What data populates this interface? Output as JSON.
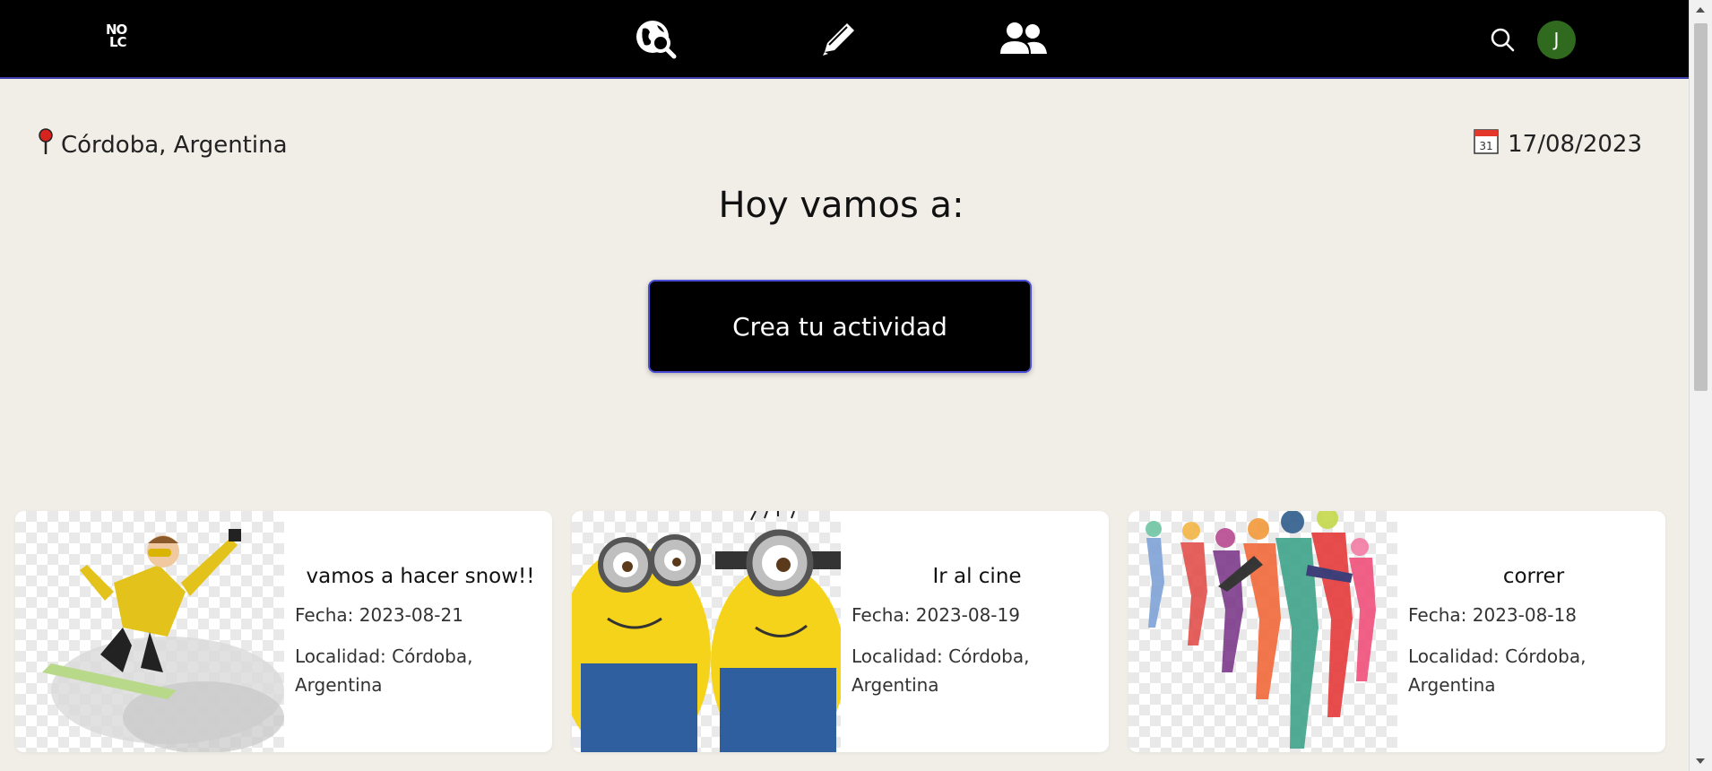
{
  "nav": {
    "logo_line1": "NO",
    "logo_line2": "LC",
    "icons": [
      "globe-search-icon",
      "pencil-icon",
      "users-icon"
    ],
    "search_icon": "search-icon",
    "avatar_initial": "J",
    "avatar_color": "#2f6a1e"
  },
  "header": {
    "location_icon": "pin-icon",
    "location": "Córdoba, Argentina",
    "date_icon": "calendar-icon",
    "calendar_day": "31",
    "date": "17/08/2023"
  },
  "main": {
    "headline": "Hoy vamos a:",
    "create_button": "Crea tu actividad"
  },
  "cards": [
    {
      "title": "vamos a hacer snow!!",
      "fecha": "Fecha: 2023-08-21",
      "localidad": "Localidad: Córdoba, Argentina",
      "image": "snowboarder-image"
    },
    {
      "title": "Ir al cine",
      "fecha": "Fecha: 2023-08-19",
      "localidad": "Localidad: Córdoba, Argentina",
      "image": "minions-image"
    },
    {
      "title": "correr",
      "fecha": "Fecha: 2023-08-18",
      "localidad": "Localidad: Córdoba, Argentina",
      "image": "runners-image"
    }
  ],
  "colors": {
    "background": "#f1eee8",
    "navbar": "#000000",
    "button_border": "#4b4fd6"
  }
}
